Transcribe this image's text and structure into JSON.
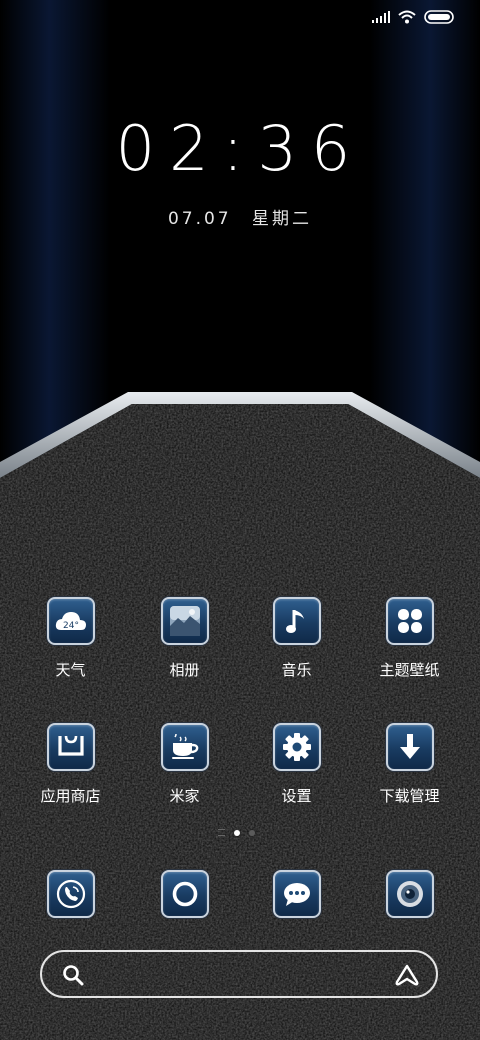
{
  "status": {
    "signal": "signal-icon",
    "wifi": "wifi-icon",
    "battery": "battery-icon"
  },
  "lockscreen": {
    "time": "02:36",
    "date": "07.07",
    "weekday": "星期二"
  },
  "apps": [
    {
      "label": "天气",
      "icon": "weather-icon",
      "temp": "24°"
    },
    {
      "label": "相册",
      "icon": "gallery-icon"
    },
    {
      "label": "音乐",
      "icon": "music-icon"
    },
    {
      "label": "主题壁纸",
      "icon": "themes-icon"
    },
    {
      "label": "应用商店",
      "icon": "app-store-icon"
    },
    {
      "label": "米家",
      "icon": "mi-home-icon"
    },
    {
      "label": "设置",
      "icon": "settings-icon"
    },
    {
      "label": "下载管理",
      "icon": "downloads-icon"
    }
  ],
  "dock": [
    {
      "icon": "phone-icon"
    },
    {
      "icon": "browser-icon"
    },
    {
      "icon": "messages-icon"
    },
    {
      "icon": "camera-icon"
    }
  ],
  "pager": {
    "pages": 2,
    "current": 1
  },
  "search": {
    "placeholder": ""
  },
  "colors": {
    "icon_top": "#2f5f8f",
    "icon_bottom": "#0f2948",
    "icon_border": "#c9d3de",
    "bezel": "#c5cbd2"
  }
}
